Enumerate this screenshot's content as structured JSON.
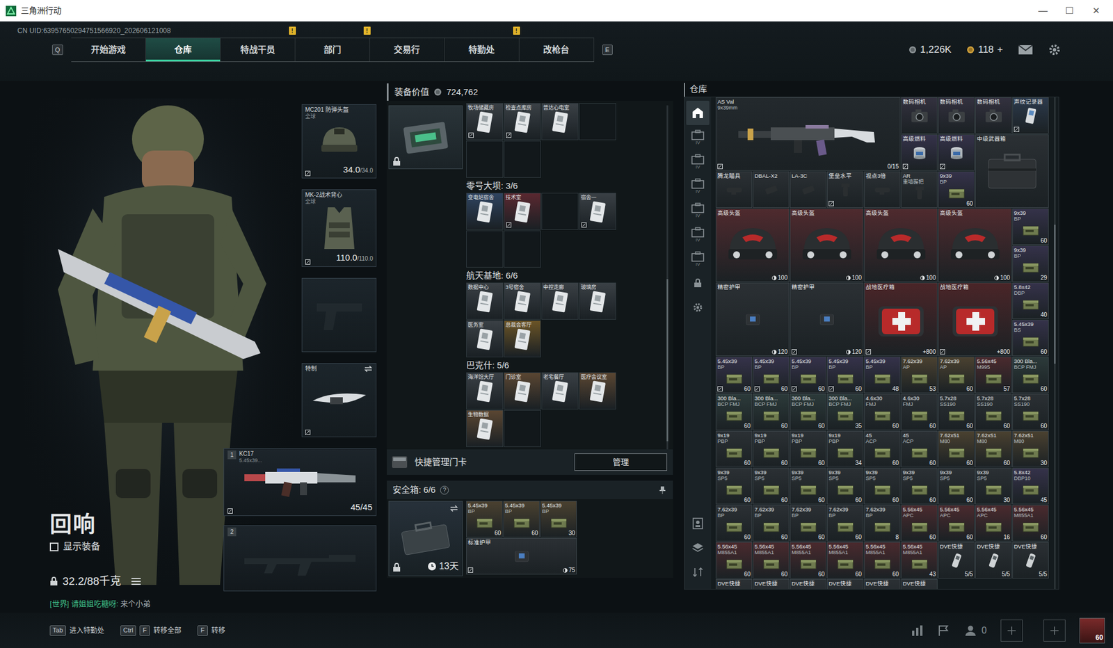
{
  "window": {
    "title": "三角洲行动",
    "controls": [
      "—",
      "☐",
      "✕"
    ]
  },
  "uid": "CN UID:63957650294751566920_202606121008",
  "nav": {
    "prev_key": "Q",
    "next_key": "E",
    "notice_glyph": "!",
    "tabs": [
      {
        "label": "开始游戏",
        "selected": false,
        "notice": false
      },
      {
        "label": "仓库",
        "selected": true,
        "notice": false
      },
      {
        "label": "特战干员",
        "selected": false,
        "notice": true
      },
      {
        "label": "部门",
        "selected": false,
        "notice": true
      },
      {
        "label": "交易行",
        "selected": false,
        "notice": false
      },
      {
        "label": "特勤处",
        "selected": false,
        "notice": true
      },
      {
        "label": "改枪台",
        "selected": false,
        "notice": false
      }
    ]
  },
  "currency": {
    "coins": "1,226K",
    "gold": "118",
    "add": "+"
  },
  "gear": [
    {
      "kind": "helmet",
      "name": "MC201 防弹头盔",
      "sub": "全球",
      "value": "34.0",
      "max": "/34.0",
      "bound": true,
      "empty": false
    },
    {
      "kind": "armor",
      "name": "MK-2战术背心",
      "sub": "全球",
      "value": "110.0",
      "max": "/110.0",
      "bound": true,
      "empty": false
    },
    {
      "kind": "pistol",
      "empty": true
    },
    {
      "kind": "melee",
      "name": "特制",
      "bound": true,
      "empty": false
    }
  ],
  "weapons": [
    {
      "slot": "1",
      "name": "KC17",
      "sub": "5.45x39...",
      "ammo": "45/45",
      "bound": true,
      "empty": false
    },
    {
      "slot": "2",
      "empty": true
    }
  ],
  "operator": {
    "name": "回响",
    "show_equipment": {
      "label": "显示装备",
      "checked": false
    },
    "weight": "32.2/88千克",
    "locked": true
  },
  "chat": {
    "channel": "[世界]",
    "sender": "请姐姐吃糖呀:",
    "message": "来个小弟"
  },
  "hotkeys": [
    {
      "keys": [
        "Tab"
      ],
      "label": "进入特勤处"
    },
    {
      "keys": [
        "Ctrl",
        "F"
      ],
      "label": "转移全部"
    },
    {
      "keys": [
        "F"
      ],
      "label": "转移"
    }
  ],
  "social": {
    "friends": "0",
    "level": "60"
  },
  "equipment_value": {
    "label": "装备价值",
    "value": "724,762"
  },
  "keys": {
    "sections": [
      {
        "slots": [
          {
            "filled": true,
            "label": "牧场储藏房",
            "color": "#3a4045",
            "bound": true
          },
          {
            "filled": true,
            "label": "检查点库房",
            "color": "#3a4045",
            "bound": true
          },
          {
            "filled": true,
            "label": "普达心电室",
            "color": "#3a4045"
          },
          {
            "filled": false
          },
          {
            "filled": false
          },
          {
            "filled": false
          }
        ]
      },
      {
        "title": "零号大坝: 3/6",
        "slots": [
          {
            "filled": true,
            "label": "变电站宿舍",
            "color": "#2f4460"
          },
          {
            "filled": true,
            "label": "技术室",
            "color": "#5a2830",
            "bound": true
          },
          {
            "filled": false
          },
          {
            "filled": true,
            "label": "宿舍一",
            "color": "#3a4045",
            "bound": true
          },
          {
            "filled": false
          },
          {
            "filled": false
          }
        ]
      },
      {
        "title": "航天基地: 6/6",
        "slots": [
          {
            "filled": true,
            "label": "数据中心",
            "color": "#3a4045"
          },
          {
            "filled": true,
            "label": "3号宿舍",
            "color": "#3a4045"
          },
          {
            "filled": true,
            "label": "中控走廊",
            "color": "#3a4045"
          },
          {
            "filled": true,
            "label": "玻璃房",
            "color": "#3a4045"
          },
          {
            "filled": true,
            "label": "医务室",
            "color": "#3a4045"
          },
          {
            "filled": true,
            "label": "总裁会客厅",
            "color": "#6b5426"
          }
        ]
      },
      {
        "title": "巴克什: 5/6",
        "slots": [
          {
            "filled": true,
            "label": "海洋馆大厅",
            "color": "#3a4045"
          },
          {
            "filled": true,
            "label": "门诊室",
            "color": "#5a4632"
          },
          {
            "filled": true,
            "label": "老宅餐厅",
            "color": "#3a4045"
          },
          {
            "filled": true,
            "label": "医疗会议室",
            "color": "#5a4632"
          },
          {
            "filled": true,
            "label": "生物数据",
            "color": "#5a4632"
          },
          {
            "filled": false
          }
        ]
      }
    ]
  },
  "quick_manage": {
    "label": "快捷管理门卡",
    "button": "管理"
  },
  "safe_box": {
    "title": "安全箱: 6/6",
    "help": "?",
    "timer": "13天",
    "items": [
      {
        "name": "5.45x39",
        "sub": "BP",
        "count": "60",
        "kind": "ammo",
        "color": "#4a4130"
      },
      {
        "name": "5.45x39",
        "sub": "BP",
        "count": "60",
        "kind": "ammo",
        "color": "#4a4130"
      },
      {
        "name": "5.45x39",
        "sub": "BP",
        "count": "30",
        "kind": "ammo",
        "color": "#4a4130"
      },
      {
        "name": "标准护甲",
        "count": "75",
        "kind": "armor",
        "color": "#2b3034",
        "wide": true,
        "durability": true,
        "bound": true
      }
    ]
  },
  "stash": {
    "title": "仓库",
    "sidebar": [
      {
        "kind": "home",
        "selected": true
      },
      {
        "kind": "box",
        "tag": "IV",
        "selected": false
      },
      {
        "kind": "box",
        "tag": "IV",
        "selected": false
      },
      {
        "kind": "box",
        "tag": "IV",
        "selected": false
      },
      {
        "kind": "box",
        "tag": "IV",
        "selected": false
      },
      {
        "kind": "box",
        "tag": "IV",
        "selected": false
      },
      {
        "kind": "box",
        "tag": "IV",
        "selected": false
      },
      {
        "kind": "lock",
        "selected": false
      },
      {
        "kind": "gear",
        "selected": false
      },
      {
        "kind": "profile",
        "selected": false
      },
      {
        "kind": "layers",
        "selected": false
      },
      {
        "kind": "sort",
        "selected": false
      }
    ],
    "items": [
      {
        "name": "AS Val",
        "sub": "9x39mm",
        "count": "0/15",
        "kind": "weapon",
        "color": "#23292d",
        "bound": true
      },
      {
        "name": "数码相机",
        "kind": "camera",
        "color": "#33313f"
      },
      {
        "name": "数码相机",
        "kind": "camera",
        "color": "#33313f"
      },
      {
        "name": "数码相机",
        "kind": "camera",
        "color": "#33313f"
      },
      {
        "name": "声纹记录器",
        "kind": "recorder",
        "color": "#2c3a4c",
        "bound": true
      },
      {
        "name": "高级燃料",
        "kind": "fuel",
        "color": "#35324a",
        "bound": true
      },
      {
        "name": "高级燃料",
        "kind": "fuel",
        "color": "#35324a",
        "bound": true
      },
      {
        "name": "中级武器箱",
        "kind": "case",
        "color": "#2b3034"
      },
      {
        "name": "腾龙瞄具",
        "kind": "scope",
        "color": "#2b3034"
      },
      {
        "name": "DBAL-X2",
        "kind": "laser",
        "color": "#2b3034"
      },
      {
        "name": "LA-3C",
        "kind": "laser",
        "color": "#2b3034"
      },
      {
        "name": "堡垒水平",
        "kind": "grip",
        "color": "#2b3034",
        "bound": true
      },
      {
        "name": "视点3倍",
        "kind": "scope",
        "color": "#2b3034"
      },
      {
        "name": "AR",
        "sub": "重墙握把",
        "kind": "grip",
        "color": "#2b3034"
      },
      {
        "name": "9x39",
        "sub": "BP",
        "count": "60",
        "kind": "ammo",
        "color": "#35324a"
      },
      {
        "name": "高级头盔",
        "count": "100",
        "kind": "helmet",
        "color": "#4f2a2e",
        "durability": true
      },
      {
        "name": "高级头盔",
        "count": "100",
        "kind": "helmet",
        "color": "#4f2a2e",
        "durability": true
      },
      {
        "name": "高级头盔",
        "count": "100",
        "kind": "helmet",
        "color": "#4f2a2e",
        "durability": true
      },
      {
        "name": "高级头盔",
        "count": "100",
        "kind": "helmet",
        "color": "#4f2a2e",
        "durability": true
      },
      {
        "name": "9x39",
        "sub": "BP",
        "count": "60",
        "kind": "ammo",
        "color": "#35324a"
      },
      {
        "name": "9x39",
        "sub": "BP",
        "count": "29",
        "kind": "ammo",
        "color": "#35324a"
      },
      {
        "name": "精密护甲",
        "count": "120",
        "kind": "armor",
        "color": "#2b3034",
        "durability": true
      },
      {
        "name": "精密护甲",
        "count": "120",
        "kind": "armor",
        "color": "#2b3034",
        "durability": true,
        "bound": true
      },
      {
        "name": "战地医疗箱",
        "count": "+800",
        "kind": "medkit",
        "color": "#4a2528",
        "bound": true
      },
      {
        "name": "战地医疗箱",
        "count": "+800",
        "kind": "medkit",
        "color": "#4a2528",
        "bound": true
      },
      {
        "name": "5.8x42",
        "sub": "DBP",
        "count": "40",
        "kind": "ammo",
        "color": "#35324a"
      },
      {
        "name": "5.45x39",
        "sub": "BS",
        "count": "60",
        "kind": "ammo",
        "color": "#35324a"
      },
      {
        "name": "5.45x39",
        "sub": "BP",
        "count": "60",
        "kind": "ammo",
        "color": "#35324a",
        "bound": true
      },
      {
        "name": "5.45x39",
        "sub": "BP",
        "count": "60",
        "kind": "ammo",
        "color": "#35324a",
        "bound": true
      },
      {
        "name": "5.45x39",
        "sub": "BP",
        "count": "60",
        "kind": "ammo",
        "color": "#35324a",
        "bound": true
      },
      {
        "name": "5.45x39",
        "sub": "BP",
        "count": "60",
        "kind": "ammo",
        "color": "#35324a",
        "bound": true
      },
      {
        "name": "5.45x39",
        "sub": "BP",
        "count": "48",
        "kind": "ammo",
        "color": "#35324a"
      },
      {
        "name": "7.62x39",
        "sub": "AP",
        "count": "53",
        "kind": "ammo",
        "color": "#4a4130"
      },
      {
        "name": "7.62x39",
        "sub": "AP",
        "count": "60",
        "kind": "ammo",
        "color": "#4a4130"
      },
      {
        "name": "5.56x45",
        "sub": "M995",
        "count": "57",
        "kind": "ammo",
        "color": "#4a2a2e"
      },
      {
        "name": "300 Bla...",
        "sub": "BCP FMJ",
        "count": "60",
        "kind": "ammo",
        "color": "#2c3a3a"
      },
      {
        "name": "300 Bla...",
        "sub": "BCP FMJ",
        "count": "60",
        "kind": "ammo",
        "color": "#2c3a3a"
      },
      {
        "name": "300 Bla...",
        "sub": "BCP FMJ",
        "count": "60",
        "kind": "ammo",
        "color": "#2c3a3a"
      },
      {
        "name": "300 Bla...",
        "sub": "BCP FMJ",
        "count": "60",
        "kind": "ammo",
        "color": "#2c3a3a"
      },
      {
        "name": "300 Bla...",
        "sub": "BCP FMJ",
        "count": "35",
        "kind": "ammo",
        "color": "#2c3a3a"
      },
      {
        "name": "4.6x30",
        "sub": "FMJ",
        "count": "60",
        "kind": "ammo",
        "color": "#2b3034"
      },
      {
        "name": "4.6x30",
        "sub": "FMJ",
        "count": "60",
        "kind": "ammo",
        "color": "#2b3034"
      },
      {
        "name": "5.7x28",
        "sub": "SS190",
        "count": "60",
        "kind": "ammo",
        "color": "#2b3034"
      },
      {
        "name": "5.7x28",
        "sub": "SS190",
        "count": "60",
        "kind": "ammo",
        "color": "#2b3034"
      },
      {
        "name": "5.7x28",
        "sub": "SS190",
        "count": "60",
        "kind": "ammo",
        "color": "#2b3034"
      },
      {
        "name": "9x19",
        "sub": "PBP",
        "count": "60",
        "kind": "ammo",
        "color": "#2b3034"
      },
      {
        "name": "9x19",
        "sub": "PBP",
        "count": "60",
        "kind": "ammo",
        "color": "#2b3034"
      },
      {
        "name": "9x19",
        "sub": "PBP",
        "count": "60",
        "kind": "ammo",
        "color": "#2b3034"
      },
      {
        "name": "9x19",
        "sub": "PBP",
        "count": "34",
        "kind": "ammo",
        "color": "#2b3034"
      },
      {
        "name": "45",
        "sub": "ACP",
        "count": "60",
        "kind": "ammo",
        "color": "#2b3034"
      },
      {
        "name": "45",
        "sub": "ACP",
        "count": "60",
        "kind": "ammo",
        "color": "#2b3034"
      },
      {
        "name": "7.62x51",
        "sub": "M80",
        "count": "60",
        "kind": "ammo",
        "color": "#4a4130"
      },
      {
        "name": "7.62x51",
        "sub": "M80",
        "count": "60",
        "kind": "ammo",
        "color": "#4a4130"
      },
      {
        "name": "7.62x51",
        "sub": "M80",
        "count": "30",
        "kind": "ammo",
        "color": "#4a4130"
      },
      {
        "name": "9x39",
        "sub": "SP5",
        "count": "60",
        "kind": "ammo",
        "color": "#2b3034"
      },
      {
        "name": "9x39",
        "sub": "SP5",
        "count": "60",
        "kind": "ammo",
        "color": "#2b3034"
      },
      {
        "name": "9x39",
        "sub": "SP5",
        "count": "60",
        "kind": "ammo",
        "color": "#2b3034"
      },
      {
        "name": "9x39",
        "sub": "SP5",
        "count": "60",
        "kind": "ammo",
        "color": "#2b3034"
      },
      {
        "name": "9x39",
        "sub": "SP5",
        "count": "60",
        "kind": "ammo",
        "color": "#2b3034"
      },
      {
        "name": "9x39",
        "sub": "SP5",
        "count": "60",
        "kind": "ammo",
        "color": "#2b3034"
      },
      {
        "name": "9x39",
        "sub": "SP5",
        "count": "60",
        "kind": "ammo",
        "color": "#2b3034"
      },
      {
        "name": "9x39",
        "sub": "SP5",
        "count": "30",
        "kind": "ammo",
        "color": "#2b3034"
      },
      {
        "name": "5.8x42",
        "sub": "DBP10",
        "count": "45",
        "kind": "ammo",
        "color": "#35324a"
      },
      {
        "name": "7.62x39",
        "sub": "BP",
        "count": "60",
        "kind": "ammo",
        "color": "#2b3034"
      },
      {
        "name": "7.62x39",
        "sub": "BP",
        "count": "60",
        "kind": "ammo",
        "color": "#2b3034"
      },
      {
        "name": "7.62x39",
        "sub": "BP",
        "count": "60",
        "kind": "ammo",
        "color": "#2b3034"
      },
      {
        "name": "7.62x39",
        "sub": "BP",
        "count": "60",
        "kind": "ammo",
        "color": "#2b3034"
      },
      {
        "name": "7.62x39",
        "sub": "BP",
        "count": "8",
        "kind": "ammo",
        "color": "#2b3034"
      },
      {
        "name": "5.56x45",
        "sub": "APC",
        "count": "60",
        "kind": "ammo",
        "color": "#4a2a2e"
      },
      {
        "name": "5.56x45",
        "sub": "APC",
        "count": "60",
        "kind": "ammo",
        "color": "#4a2a2e"
      },
      {
        "name": "5.56x45",
        "sub": "APC",
        "count": "16",
        "kind": "ammo",
        "color": "#4a2a2e"
      },
      {
        "name": "5.56x45",
        "sub": "M855A1",
        "count": "60",
        "kind": "ammo",
        "color": "#4a2a2e"
      },
      {
        "name": "5.56x45",
        "sub": "M855A1",
        "count": "60",
        "kind": "ammo",
        "color": "#4a2a2e"
      },
      {
        "name": "5.56x45",
        "sub": "M855A1",
        "count": "60",
        "kind": "ammo",
        "color": "#4a2a2e"
      },
      {
        "name": "5.56x45",
        "sub": "M855A1",
        "count": "60",
        "kind": "ammo",
        "color": "#4a2a2e"
      },
      {
        "name": "5.56x45",
        "sub": "M855A1",
        "count": "60",
        "kind": "ammo",
        "color": "#4a2a2e"
      },
      {
        "name": "5.56x45",
        "sub": "M855A1",
        "count": "60",
        "kind": "ammo",
        "color": "#4a2a2e"
      },
      {
        "name": "5.56x45",
        "sub": "M855A1",
        "count": "43",
        "kind": "ammo",
        "color": "#4a2a2e"
      },
      {
        "name": "DVE快捷",
        "count": "5/5",
        "kind": "dve",
        "color": "#2b3034"
      },
      {
        "name": "DVE快捷",
        "count": "5/5",
        "kind": "dve",
        "color": "#2b3034"
      },
      {
        "name": "DVE快捷",
        "count": "5/5",
        "kind": "dve",
        "color": "#2b3034"
      },
      {
        "name": "DVE快捷",
        "kind": "dve",
        "color": "#2b3034"
      },
      {
        "name": "DVE快捷",
        "kind": "dve",
        "color": "#2b3034"
      },
      {
        "name": "DVE快捷",
        "kind": "dve",
        "color": "#2b3034"
      },
      {
        "name": "DVE快捷",
        "kind": "dve",
        "color": "#2b3034"
      },
      {
        "name": "DVE快捷",
        "kind": "dve",
        "color": "#2b3034"
      },
      {
        "name": "DVE快捷",
        "kind": "dve",
        "color": "#2b3034"
      }
    ]
  }
}
